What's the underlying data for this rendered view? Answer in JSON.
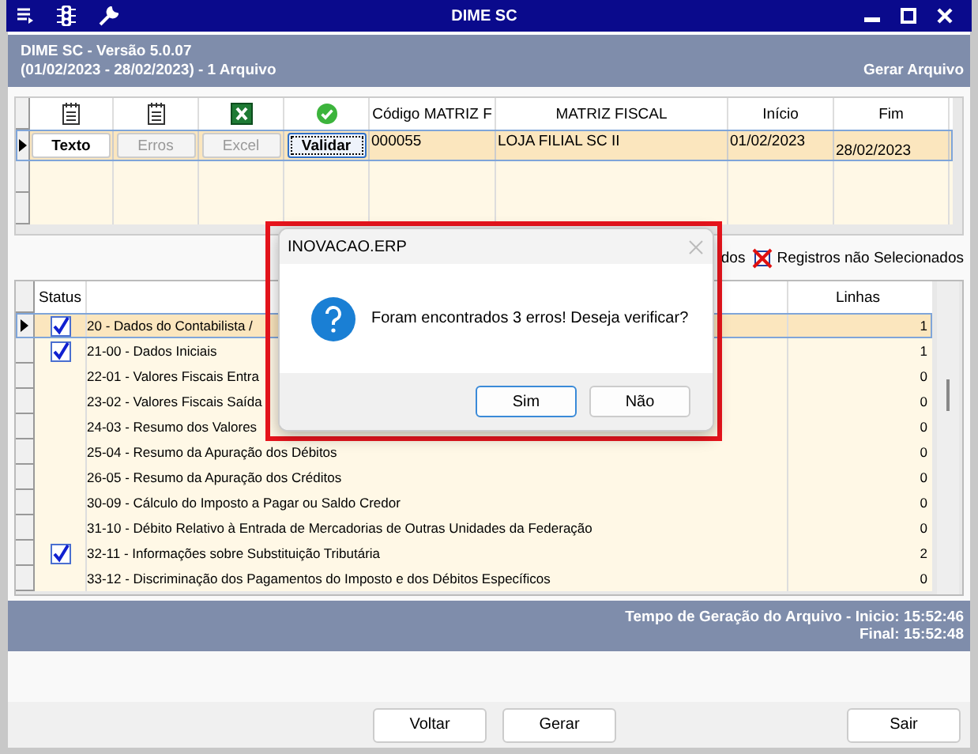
{
  "window": {
    "title": "DIME SC"
  },
  "header": {
    "title": "DIME SC - Versão 5.0.07",
    "period": "(01/02/2023 - 28/02/2023) - 1 Arquivo",
    "action": "Gerar Arquivo"
  },
  "files": {
    "columns": [
      {
        "kind": "notepad"
      },
      {
        "kind": "notepad"
      },
      {
        "kind": "excel"
      },
      {
        "kind": "check"
      },
      {
        "kind": "text",
        "label": "Código MATRIZ F"
      },
      {
        "kind": "text",
        "label": "MATRIZ FISCAL"
      },
      {
        "kind": "text",
        "label": "Início"
      },
      {
        "kind": "text",
        "label": "Fim"
      }
    ],
    "rows": [
      {
        "selected": true,
        "buttons": [
          {
            "label": "Texto",
            "disabled": false,
            "focused": false
          },
          {
            "label": "Erros",
            "disabled": true,
            "focused": false
          },
          {
            "label": "Excel",
            "disabled": true,
            "focused": false
          },
          {
            "label": "Validar",
            "disabled": false,
            "focused": true
          }
        ],
        "codigo": "000055",
        "matriz": "LOJA FILIAL SC II",
        "inicio": "01/02/2023",
        "fim": "28/02/2023"
      }
    ]
  },
  "legend": [
    {
      "label": "dos",
      "kind": "text"
    },
    {
      "label": "Registros não Selecionados",
      "kind": "cross"
    }
  ],
  "records": {
    "columns": [
      "Status",
      "Linhas"
    ],
    "rows": [
      {
        "selected": true,
        "checked": true,
        "name": "20 - Dados do Contabilista /",
        "lines": "1"
      },
      {
        "selected": false,
        "checked": true,
        "name": "21-00 - Dados Iniciais",
        "lines": "1"
      },
      {
        "selected": false,
        "checked": false,
        "name": "22-01 - Valores Fiscais Entra",
        "lines": "0"
      },
      {
        "selected": false,
        "checked": false,
        "name": "23-02 - Valores Fiscais Saída",
        "lines": "0"
      },
      {
        "selected": false,
        "checked": false,
        "name": "24-03 - Resumo dos Valores",
        "lines": "0"
      },
      {
        "selected": false,
        "checked": false,
        "name": "25-04 - Resumo da Apuração dos Débitos",
        "lines": "0"
      },
      {
        "selected": false,
        "checked": false,
        "name": "26-05 - Resumo da Apuração dos Créditos",
        "lines": "0"
      },
      {
        "selected": false,
        "checked": false,
        "name": "30-09 - Cálculo do Imposto a Pagar ou Saldo Credor",
        "lines": "0"
      },
      {
        "selected": false,
        "checked": false,
        "name": "31-10 - Débito Relativo à Entrada de Mercadorias de Outras Unidades da Federação",
        "lines": "0"
      },
      {
        "selected": false,
        "checked": true,
        "name": "32-11 - Informações sobre Substituição Tributária",
        "lines": "2"
      },
      {
        "selected": false,
        "checked": false,
        "name": "33-12 - Discriminação dos Pagamentos do Imposto e dos Débitos Específicos",
        "lines": "0"
      }
    ]
  },
  "status": [
    "Tempo de Geração do Arquivo - Inicio: 15:52:46",
    "Final: 15:52:48"
  ],
  "buttons": [
    {
      "label": "Voltar"
    },
    {
      "label": "Gerar"
    },
    {
      "label": "Sair"
    }
  ],
  "dialog": {
    "title": "INOVACAO.ERP",
    "message": "Foram encontrados 3 erros! Deseja verificar?",
    "buttons": [
      {
        "label": "Sim",
        "default": true
      },
      {
        "label": "Não",
        "default": false
      }
    ]
  }
}
